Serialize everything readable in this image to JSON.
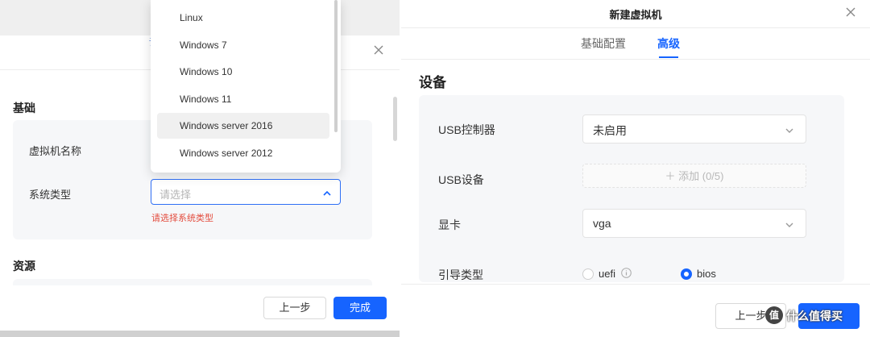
{
  "left": {
    "section_basic": "基础",
    "label_vm_name": "虚拟机名称",
    "label_system_type": "系统类型",
    "system_type_placeholder": "请选择",
    "error_text": "请选择系统类型",
    "section_resources": "资源",
    "prev_button": "上一步",
    "done_button": "完成",
    "cut_tab_text": "请",
    "dropdown_options": [
      "Linux",
      "Windows 7",
      "Windows 10",
      "Windows 11",
      "Windows server 2016",
      "Windows server 2012"
    ],
    "dropdown_highlighted": "Windows server 2016"
  },
  "right": {
    "title": "新建虚拟机",
    "tabs": [
      {
        "label": "基础配置",
        "active": false
      },
      {
        "label": "高级",
        "active": true
      }
    ],
    "section_devices": "设备",
    "usb_controller_label": "USB控制器",
    "usb_controller_value": "未启用",
    "usb_device_label": "USB设备",
    "usb_device_add": "＋ 添加 (0/5)",
    "graphics_label": "显卡",
    "graphics_value": "vga",
    "boot_type_label": "引导类型",
    "boot_options": [
      {
        "label": "uefi",
        "selected": false
      },
      {
        "label": "bios",
        "selected": true
      }
    ],
    "prev_button": "上一步",
    "watermark_text": "什么值得买"
  },
  "colors": {
    "primary": "#1664ff",
    "error": "#e34d3f",
    "card_bg": "#f6f7f9"
  }
}
